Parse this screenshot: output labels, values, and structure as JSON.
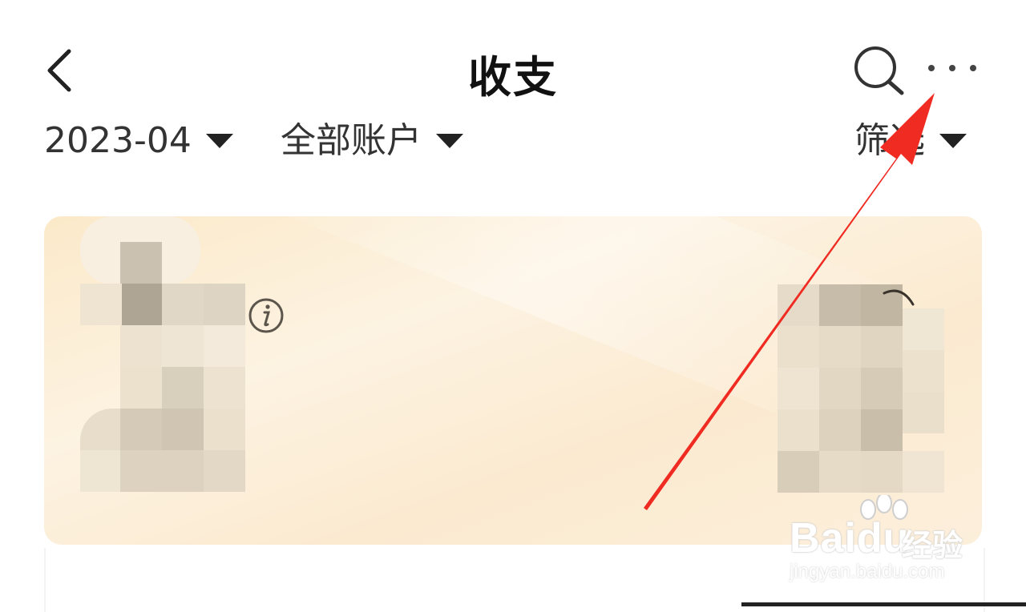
{
  "header": {
    "title": "收支",
    "back_icon": "chevron-left-icon",
    "search_icon": "search-icon",
    "more_icon": "more-horizontal-icon"
  },
  "filters": {
    "month": "2023-04",
    "account": "全部账户",
    "screen": "筛选"
  },
  "summary_card": {
    "background": "#fbead0",
    "info_icon": "info-icon"
  },
  "annotation": {
    "arrow_color": "#ef2b22"
  },
  "watermark": {
    "brand": "Baidu",
    "suffix": "经验",
    "url": "jingyan.baidu.com"
  }
}
